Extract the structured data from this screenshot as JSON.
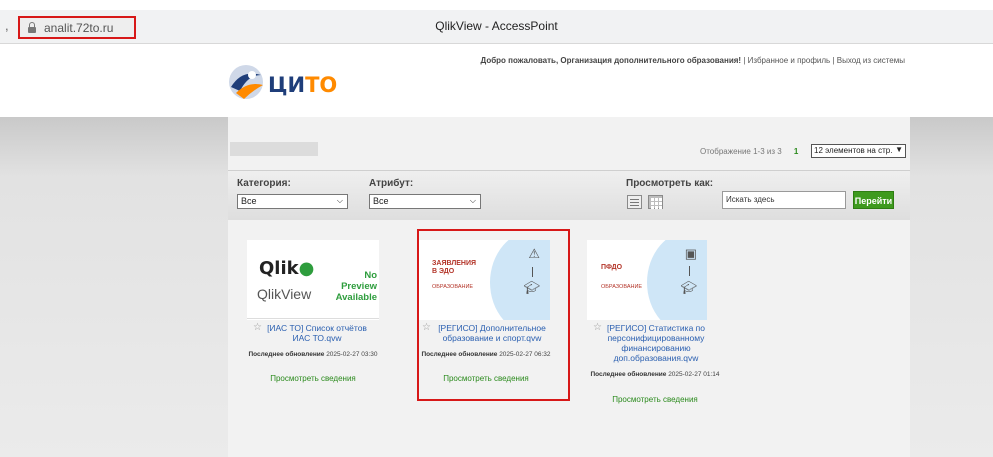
{
  "browser": {
    "left_glyph": ",",
    "url": "analit.72to.ru",
    "window_title": "QlikView - AccessPoint"
  },
  "header": {
    "welcome_prefix": "Добро пожаловать, Организация дополнительного образования!",
    "welcome_links": "| Избранное и профиль | Выход из системы",
    "logo_text_main": "ЦИ",
    "logo_text_accent": "ТО"
  },
  "toolbar": {
    "display_text": "Отображение 1-3 из 3",
    "page_number": "1",
    "page_size_value": "12 элементов на стр."
  },
  "filters": {
    "category_label": "Категория:",
    "category_value": "Все",
    "attribute_label": "Атрибут:",
    "attribute_value": "Все",
    "view_as_label": "Просмотреть как:",
    "search_placeholder": "Искать здесь",
    "go_label": "Перейти"
  },
  "documents": [
    {
      "title": "[ИАС ТО] Список отчётов ИАС ТО.qvw",
      "updated_label": "Последнее обновление",
      "updated_value": "2025-02-27 03:30",
      "details_label": "Просмотреть сведения",
      "thumb_brand": "Qlik",
      "thumb_product": "QlikView",
      "thumb_note": "No Preview Available"
    },
    {
      "title": "[РЕГИСО] Дополнительное образование и спорт.qvw",
      "updated_label": "Последнее обновление",
      "updated_value": "2025-02-27 06:32",
      "details_label": "Просмотреть сведения",
      "thumb_title": "ЗАЯВЛЕНИЯ В ЭДО",
      "thumb_sub": "ОБРАЗОВАНИЕ"
    },
    {
      "title": "[РЕГИСО] Статистика по персонифицированному финансированию доп.образования.qvw",
      "updated_label": "Последнее обновление",
      "updated_value": "2025-02-27 01:14",
      "details_label": "Просмотреть сведения",
      "thumb_title": "ПФДО",
      "thumb_sub": "ОБРАЗОВАНИЕ"
    }
  ],
  "colors": {
    "accent_green": "#3e9a1e",
    "link_blue": "#2a5fb0",
    "highlight_red": "#d71818",
    "logo_blue": "#1f3e7a",
    "logo_orange": "#ff8a00"
  }
}
